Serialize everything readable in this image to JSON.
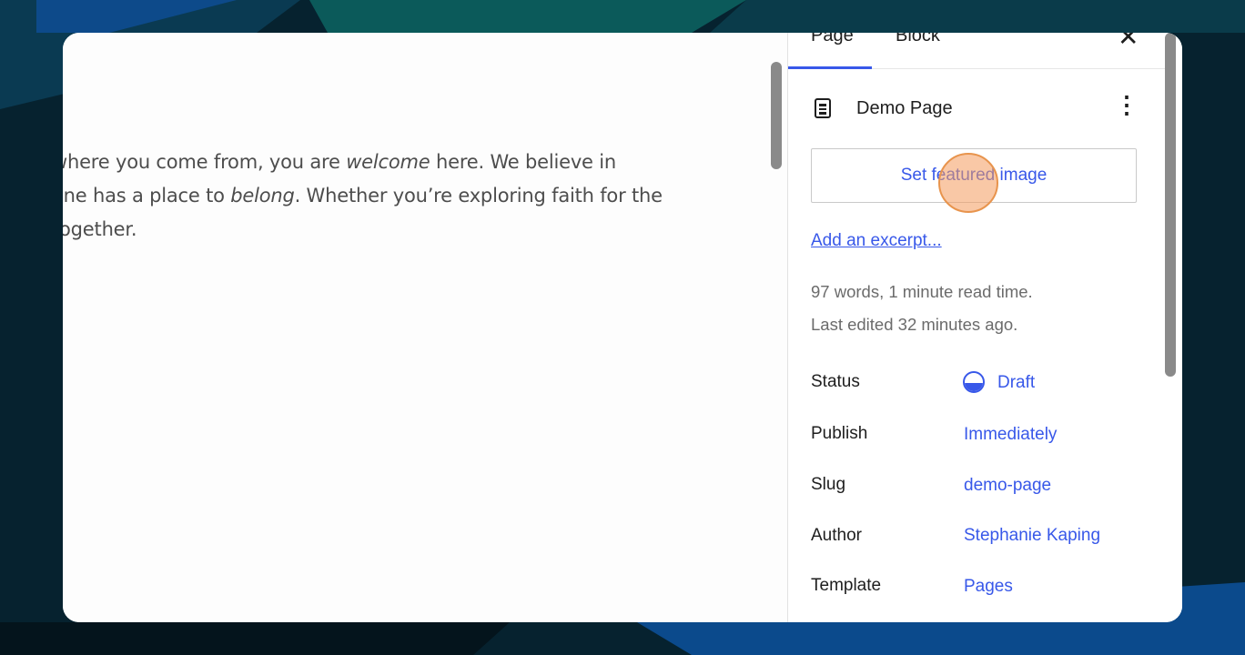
{
  "editor_content": {
    "line1_a": "where you come from, you are ",
    "line1_em": "welcome",
    "line1_b": " here. We believe in",
    "line2_a": "one has a place to ",
    "line2_em": "belong",
    "line2_b": ". Whether you’re exploring faith for the",
    "line3": "together."
  },
  "sidebar": {
    "tabs": {
      "page": "Page",
      "block": "Block"
    },
    "close_icon": "✕",
    "doc_title": "Demo Page",
    "more_icon": "⋮",
    "featured_button": "Set featured image",
    "excerpt_link": "Add an excerpt...",
    "word_count": "97 words, 1 minute read time.",
    "last_edited": "Last edited 32 minutes ago.",
    "fields": {
      "status": {
        "label": "Status",
        "value": "Draft"
      },
      "publish": {
        "label": "Publish",
        "value": "Immediately"
      },
      "slug": {
        "label": "Slug",
        "value": "demo-page"
      },
      "author": {
        "label": "Author",
        "value": "Stephanie Kaping"
      },
      "template": {
        "label": "Template",
        "value": "Pages"
      }
    }
  },
  "colors": {
    "accent": "#3858e9",
    "click_marker": "#f49a5c"
  }
}
